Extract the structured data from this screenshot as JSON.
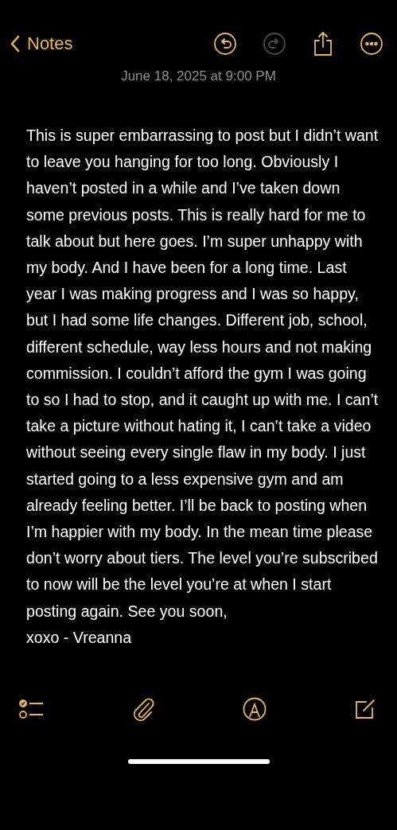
{
  "nav": {
    "back_label": "Notes",
    "actions": [
      {
        "kind": "undo",
        "disabled": false
      },
      {
        "kind": "redo",
        "disabled": true
      },
      {
        "kind": "share",
        "disabled": false
      },
      {
        "kind": "more",
        "disabled": false
      }
    ]
  },
  "note": {
    "date": "June 18, 2025 at 9:00 PM",
    "paragraphs": [
      "This is super embarrassing to post but I didn’t want to leave you hanging for too long. Obviously I haven’t posted in a while and I’ve taken down some previous posts. This is really hard for me to talk about but here goes. I’m super unhappy with my body. And I have been for a long time. Last year I was making progress and I was so happy, but I had some life changes. Different job, school, different schedule, way less hours and not making commission. I couldn’t afford the gym I was going to so I had to stop, and it caught up with me. I can’t take a picture without hating it, I can’t take a video without seeing every single flaw in my body. I just started going to a less expensive gym and am already feeling better. I’ll be back to posting when I’m happier with my body. In the mean time please don’t worry about tiers. The level you’re subscribed to now will be the level you’re at when I start posting again. See you soon,",
      "xoxo - Vreanna"
    ]
  },
  "bottom_toolbar": [
    {
      "kind": "checklist"
    },
    {
      "kind": "attach"
    },
    {
      "kind": "markup"
    },
    {
      "kind": "compose"
    }
  ]
}
